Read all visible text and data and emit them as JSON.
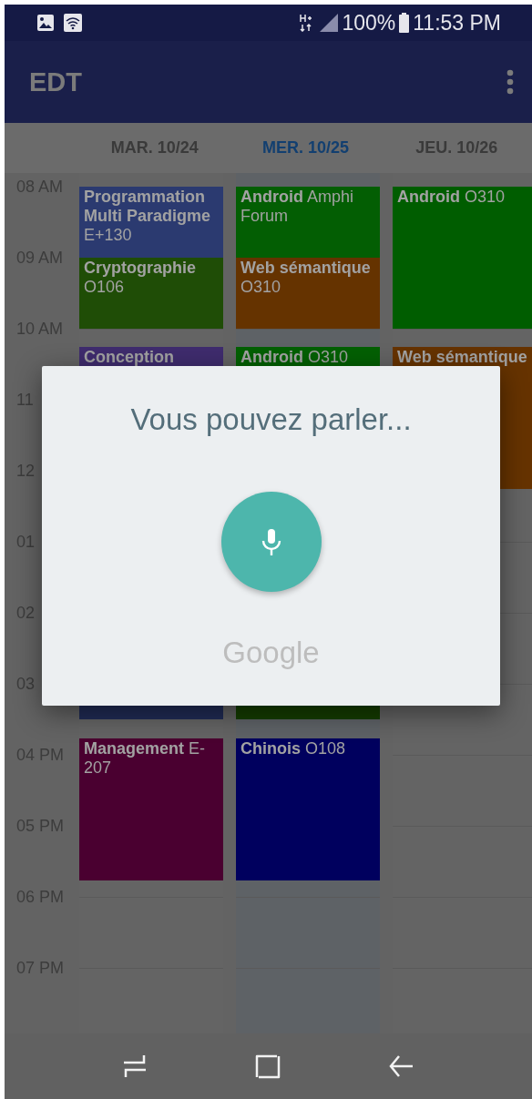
{
  "status_bar": {
    "battery": "100%",
    "time": "11:53 PM"
  },
  "app_bar": {
    "title": "EDT"
  },
  "days": [
    {
      "label": "MAR. 10/24",
      "selected": false
    },
    {
      "label": "MER. 10/25",
      "selected": true
    },
    {
      "label": "JEU. 10/26",
      "selected": false
    }
  ],
  "hours": [
    "08 AM",
    "09 AM",
    "10 AM",
    "11",
    "12",
    "01",
    "02",
    "03",
    "04 PM",
    "05 PM",
    "06 PM",
    "07 PM"
  ],
  "events": [
    [
      {
        "text": "**Programmation Multi Paradigme** E+130",
        "color": "#2b3a70"
      },
      {
        "text": "**Cryptographie** O106",
        "color": "#1f4d06"
      },
      {
        "text": "**Conception**",
        "color": "#3f2c6e"
      },
      {
        "color": "#202b55"
      },
      {
        "text": "**Management** E-207",
        "color": "#4a0030"
      }
    ],
    [
      {
        "text": "**Android** Amphi Forum",
        "color": "#035e03"
      },
      {
        "text": "**Web sémantique** O310",
        "color": "#653300"
      },
      {
        "text": "**Android** O310",
        "color": "#036003"
      },
      {
        "color": "#153d00"
      },
      {
        "text": "**Chinois** O108",
        "color": "#00005e"
      }
    ],
    [
      {
        "text": "**Android** O310",
        "color": "#005d00"
      },
      {
        "text": "**Web sémantique**",
        "color": "#663300"
      }
    ]
  ],
  "dialog": {
    "title": "Vous pouvez parler...",
    "brand": "Google"
  }
}
